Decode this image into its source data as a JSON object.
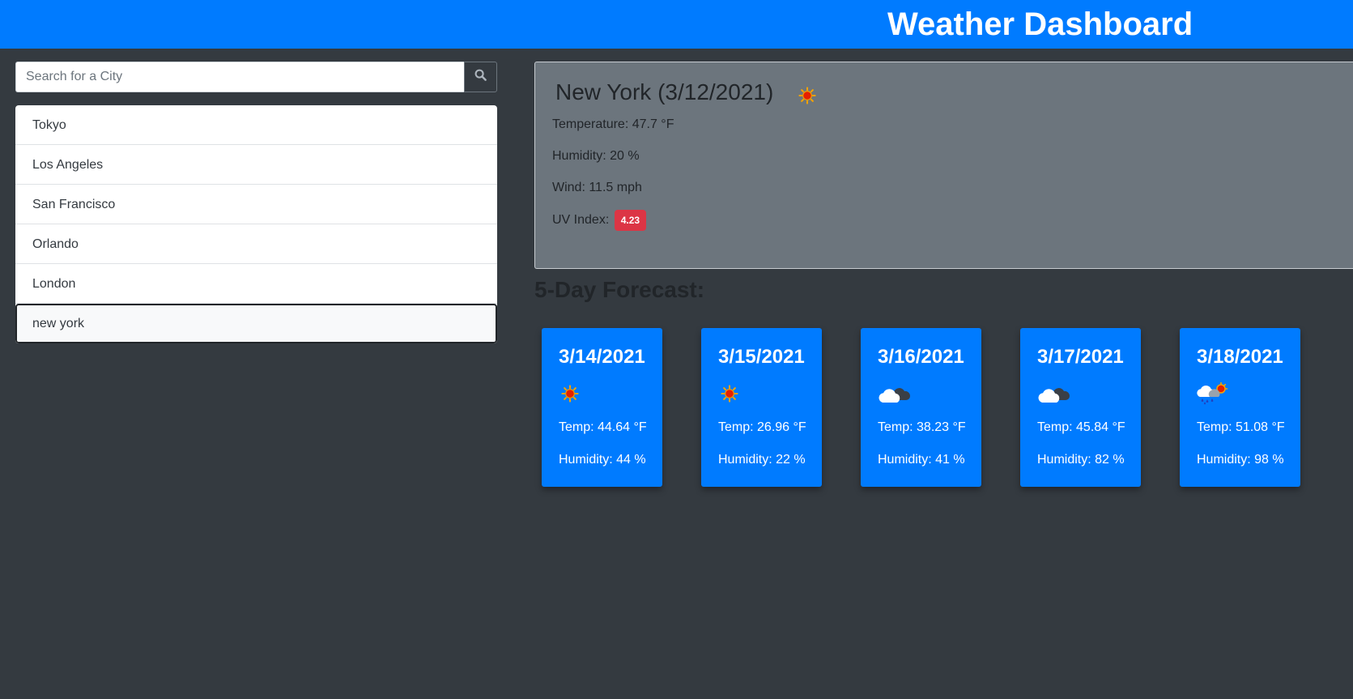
{
  "header": {
    "title": "Weather Dashboard"
  },
  "search": {
    "placeholder": "Search for a City",
    "icon": "search-icon"
  },
  "history": [
    {
      "label": "Tokyo"
    },
    {
      "label": "Los Angeles"
    },
    {
      "label": "San Francisco"
    },
    {
      "label": "Orlando"
    },
    {
      "label": "London"
    },
    {
      "label": "new york",
      "active": true
    }
  ],
  "current": {
    "title": "New York (3/12/2021)",
    "icon": "sun-icon",
    "temperature": "Temperature: 47.7 °F",
    "humidity": "Humidity: 20 %",
    "wind": "Wind: 11.5 mph",
    "uv_label": "UV Index:",
    "uv_value": "4.23",
    "uv_color": "#dc3545"
  },
  "forecast": {
    "heading": "5-Day Forecast:",
    "days": [
      {
        "date": "3/14/2021",
        "icon": "sun-icon",
        "temp": "Temp: 44.64 °F",
        "humidity": "Humidity: 44 %"
      },
      {
        "date": "3/15/2021",
        "icon": "sun-icon",
        "temp": "Temp: 26.96 °F",
        "humidity": "Humidity: 22 %"
      },
      {
        "date": "3/16/2021",
        "icon": "cloud-icon",
        "temp": "Temp: 38.23 °F",
        "humidity": "Humidity: 41 %"
      },
      {
        "date": "3/17/2021",
        "icon": "cloud-icon",
        "temp": "Temp: 45.84 °F",
        "humidity": "Humidity: 82 %"
      },
      {
        "date": "3/18/2021",
        "icon": "rain-sun-icon",
        "temp": "Temp: 51.08 °F",
        "humidity": "Humidity: 98 %"
      }
    ]
  },
  "colors": {
    "primary": "#007bff",
    "background": "#343a40",
    "card": "#6c757d",
    "danger": "#dc3545"
  }
}
